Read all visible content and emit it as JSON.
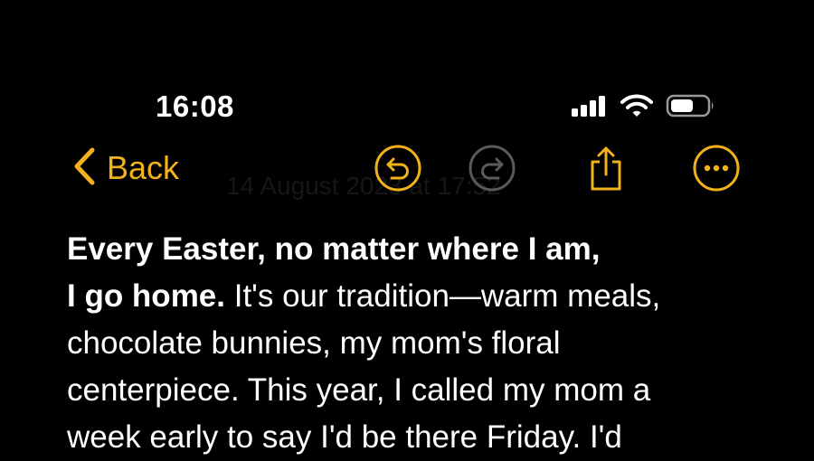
{
  "colors": {
    "background": "#000000",
    "accent": "#f1b21b",
    "disabled": "#5a5a5a",
    "text": "#ffffff"
  },
  "status_bar": {
    "time": "16:08",
    "icons": [
      "cellular-signal-icon",
      "wifi-icon",
      "battery-icon"
    ]
  },
  "toolbar": {
    "back_label": "Back",
    "date_ghost": "14 August 2023 at 17:52",
    "icons": [
      "chevron-left-icon",
      "undo-icon",
      "redo-icon",
      "share-icon",
      "more-icon"
    ]
  },
  "note": {
    "line1_bold": "Every Easter, no matter where I am,",
    "line2_bold": "I go home.",
    "line2_rest": " It's our tradition—warm meals,",
    "line3": "chocolate bunnies, my mom's floral",
    "line4": "centerpiece. This year, I called my mom a",
    "line5": "week early to say I'd be there Friday. I'd"
  }
}
